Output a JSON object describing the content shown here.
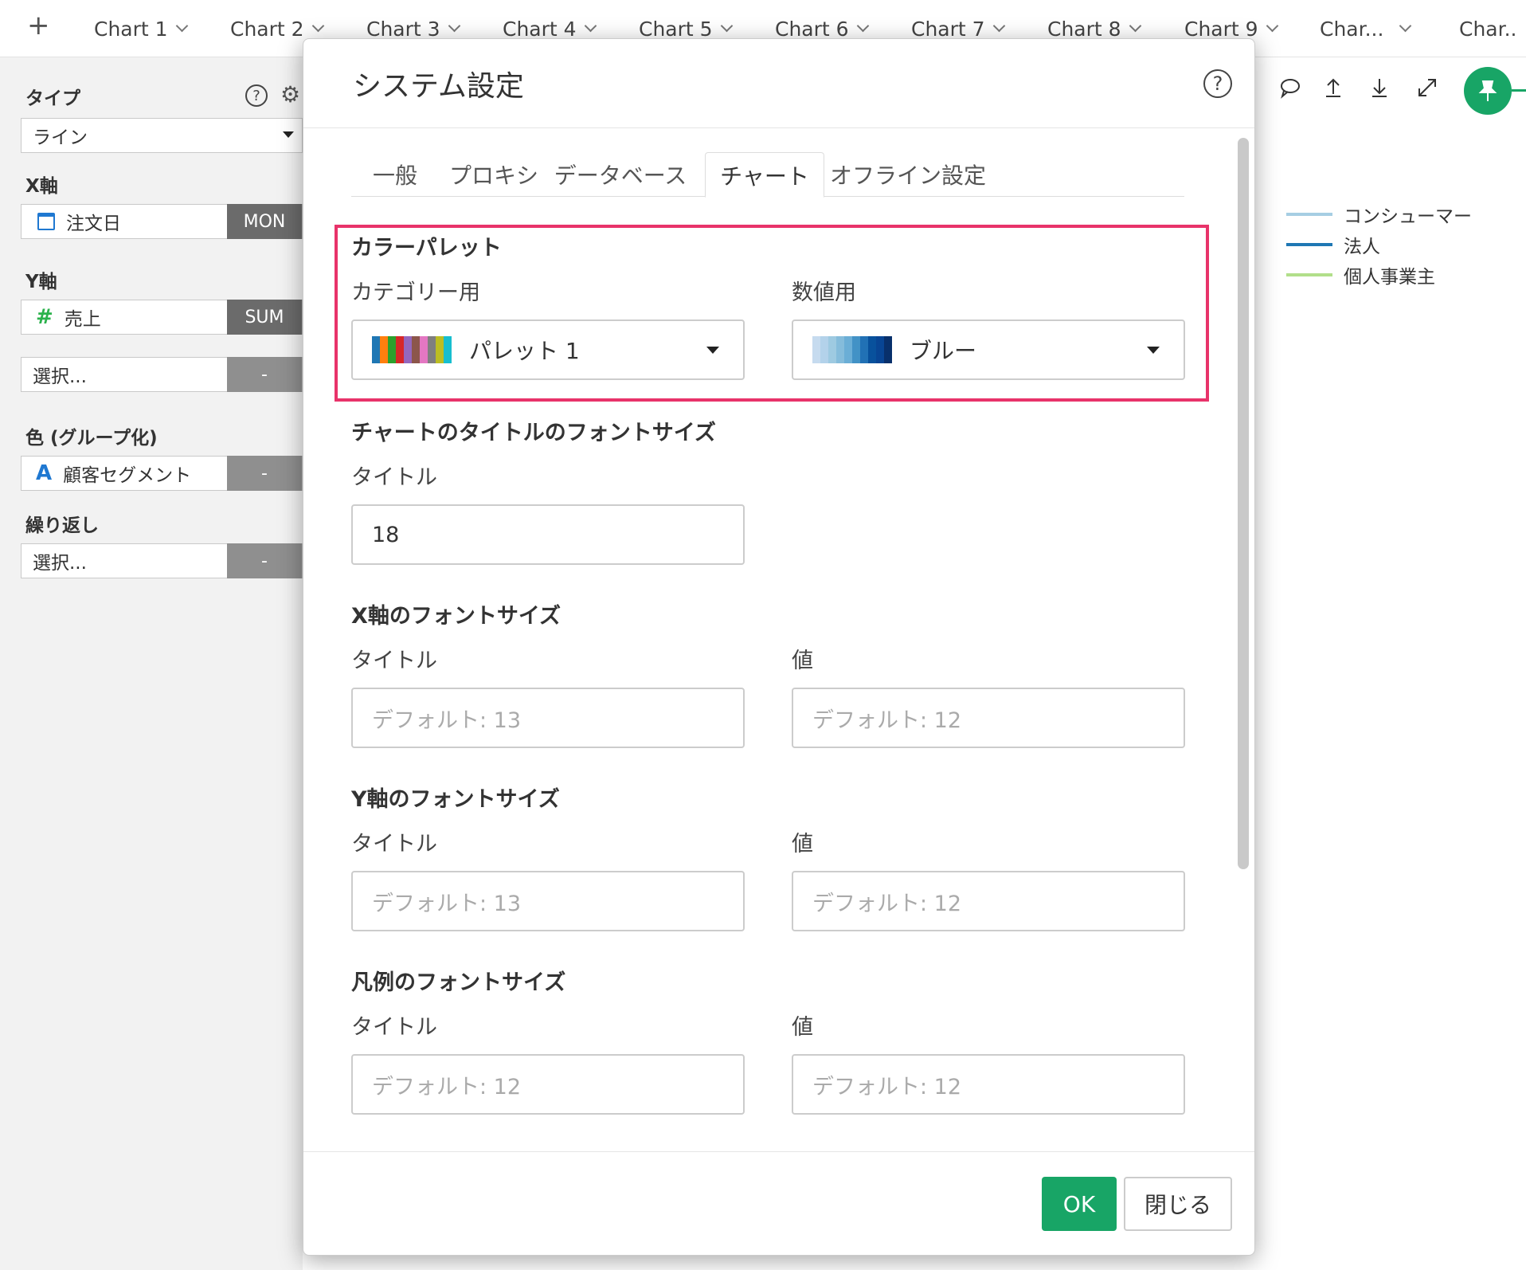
{
  "tabbar": {
    "add": "+",
    "tabs": [
      "Chart 1",
      "Chart 2",
      "Chart 3",
      "Chart 4",
      "Chart 5",
      "Chart 6",
      "Chart 7",
      "Chart 8",
      "Chart 9",
      "Char...",
      "Char.."
    ]
  },
  "left": {
    "type_label": "タイプ",
    "type_value": "ライン",
    "x_label": "X軸",
    "x_field": "注文日",
    "x_agg": "MON",
    "y_label": "Y軸",
    "y_field": "売上",
    "y_agg": "SUM",
    "y2_field": "選択...",
    "y2_agg": "-",
    "color_label": "色 (グループ化)",
    "color_field": "顧客セグメント",
    "color_agg": "-",
    "repeat_label": "繰り返し",
    "repeat_field": "選択...",
    "repeat_agg": "-",
    "help": "?"
  },
  "legend": [
    {
      "name": "コンシューマー",
      "color": "#a6cee3"
    },
    {
      "name": "法人",
      "color": "#1f78b4"
    },
    {
      "name": "個人事業主",
      "color": "#b2df8a"
    }
  ],
  "modal": {
    "title": "システム設定",
    "help": "?",
    "tabs": [
      "一般",
      "プロキシ",
      "データベース",
      "チャート",
      "オフライン設定"
    ],
    "active_tab": "チャート",
    "palette_section": "カラーパレット",
    "category_label": "カテゴリー用",
    "category_value": "パレット 1",
    "category_colors": [
      "#1f77b4",
      "#ff7f0e",
      "#2ca02c",
      "#d62728",
      "#9467bd",
      "#8c564b",
      "#e377c2",
      "#7f7f7f",
      "#bcbd22",
      "#17becf"
    ],
    "numeric_label": "数値用",
    "numeric_value": "ブルー",
    "numeric_colors": [
      "#c6dbef",
      "#b3d2ea",
      "#9ecae1",
      "#85bcdb",
      "#6baed6",
      "#4292c6",
      "#2171b5",
      "#08519c",
      "#084594",
      "#08306b"
    ],
    "title_font_section": "チャートのタイトルのフォントサイズ",
    "title_label": "タイトル",
    "title_value": "18",
    "x_font_section": "X軸のフォントサイズ",
    "x_title_label": "タイトル",
    "x_title_ph": "デフォルト: 13",
    "x_value_label": "値",
    "x_value_ph": "デフォルト: 12",
    "y_font_section": "Y軸のフォントサイズ",
    "y_title_label": "タイトル",
    "y_title_ph": "デフォルト: 13",
    "y_value_label": "値",
    "y_value_ph": "デフォルト: 12",
    "legend_font_section": "凡例のフォントサイズ",
    "legend_title_label": "タイトル",
    "legend_title_ph": "デフォルト: 12",
    "legend_value_label": "値",
    "legend_value_ph": "デフォルト: 12",
    "ok": "OK",
    "close": "閉じる"
  },
  "colors": {
    "accent": "#18a566",
    "highlight": "#e8336a"
  }
}
